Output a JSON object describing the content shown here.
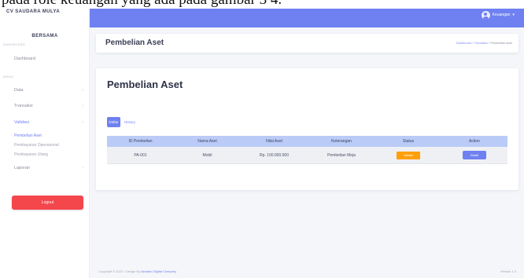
{
  "caption": "pada role keuangan yang ada pada gambar 3 4.",
  "sidebar": {
    "brand_line1": "CV SAUDARA MULYA",
    "brand_line2": "BERSAMA",
    "section_dashboard": "DASHBOARD",
    "dashboard_label": "Dashboard",
    "section_menu": "MENU",
    "items": [
      {
        "label": "Data",
        "chevron": "›"
      },
      {
        "label": "Transaksi",
        "chevron": "›"
      },
      {
        "label": "Validasi",
        "chevron": "›"
      },
      {
        "label": "Laporan",
        "chevron": "›"
      }
    ],
    "subitems": [
      {
        "label": "Pembelian Aset"
      },
      {
        "label": "Pembayaran Operasional"
      },
      {
        "label": "Pembayaran Utang"
      }
    ],
    "logout_label": "Logout"
  },
  "topbar": {
    "user_name": "Keuangan",
    "user_caret": "▾"
  },
  "header": {
    "title": "Pembelian Aset",
    "breadcrumb": [
      "Dashboard",
      "Transaksi",
      "Pembelian Aset"
    ],
    "separator": "/"
  },
  "content": {
    "title": "Pembelian Aset",
    "tabs": [
      {
        "label": "Daftar",
        "active": true
      },
      {
        "label": "History",
        "active": false
      }
    ],
    "table": {
      "columns": [
        "ID Pembelian",
        "Nama Aset",
        "Nilai Aset",
        "Keterangan",
        "Status",
        "Action"
      ],
      "rows": [
        {
          "id": "PA-001",
          "nama": "Mobil",
          "nilai": "Rp. 100.000.000",
          "keterangan": "Pembelian Meja",
          "status": "Validasi",
          "action": "Detail"
        }
      ]
    }
  },
  "footer": {
    "copyright_prefix": "Copyright © 2022 • Design By",
    "copyright_link": "Akuntan Digital Company",
    "version": "Version 1.0"
  },
  "colors": {
    "primary": "#6f80f1",
    "danger": "#f4474c",
    "warning": "#ff9f0a",
    "table_header": "#b9cbf6"
  }
}
